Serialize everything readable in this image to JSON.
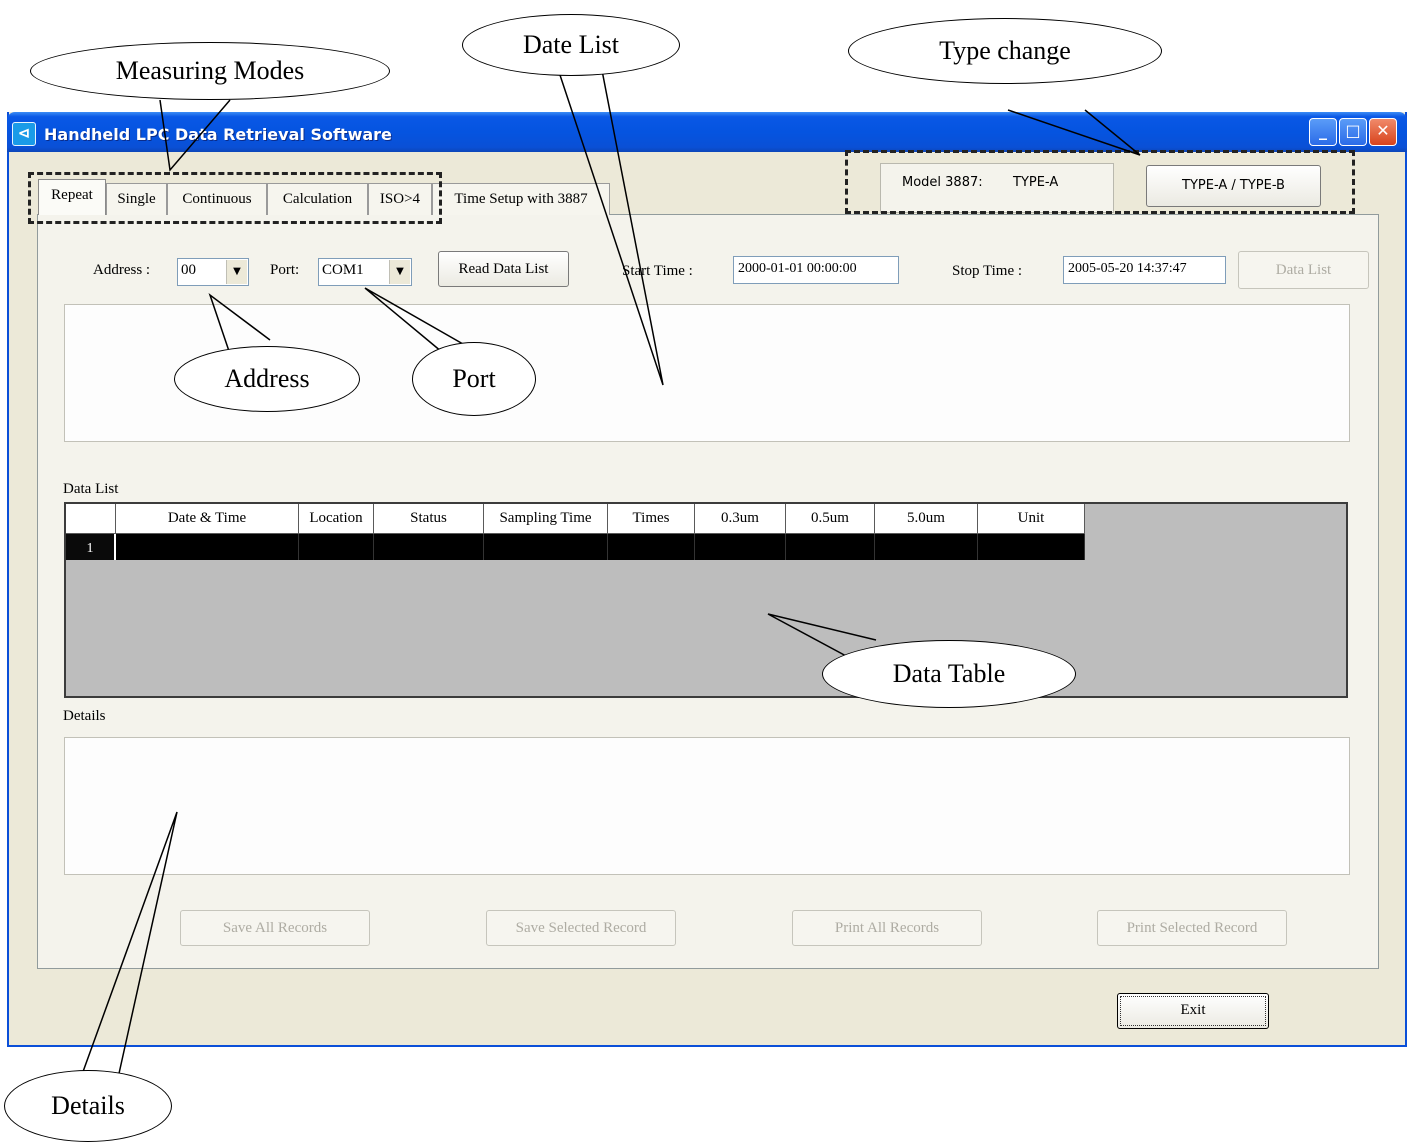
{
  "window": {
    "title": "Handheld LPC Data Retrieval Software",
    "icon": "app-icon",
    "controls": {
      "minimize": "_",
      "maximize": "□",
      "close": "✕"
    }
  },
  "tabs": [
    "Repeat",
    "Single",
    "Continuous",
    "Calculation",
    "ISO>4",
    "Time Setup with 3887"
  ],
  "active_tab": "Repeat",
  "model": {
    "label": "Model 3887:",
    "type": "TYPE-A",
    "toggle_button": "TYPE-A / TYPE-B"
  },
  "controls": {
    "address_label": "Address :",
    "address_value": "00",
    "port_label": "Port:",
    "port_value": "COM1",
    "read_button": "Read Data List",
    "start_label": "Start Time :",
    "start_value": "2000-01-01 00:00:00",
    "stop_label": "Stop Time :",
    "stop_value": "2005-05-20 14:37:47",
    "data_list_button": "Data List"
  },
  "data_list": {
    "label": "Data List",
    "columns": [
      "Date & Time",
      "Location",
      "Status",
      "Sampling Time",
      "Times",
      "0.3um",
      "0.5um",
      "5.0um",
      "Unit"
    ],
    "rows": [
      {
        "index": "1"
      }
    ]
  },
  "details": {
    "label": "Details"
  },
  "buttons": {
    "save_all": "Save All Records",
    "save_selected": "Save Selected Record",
    "print_all": "Print All Records",
    "print_selected": "Print Selected Record",
    "exit": "Exit"
  },
  "annotations": {
    "measuring_modes": "Measuring Modes",
    "date_list": "Date List",
    "type_change": "Type change",
    "address": "Address",
    "port": "Port",
    "data_table": "Data Table",
    "details": "Details"
  }
}
